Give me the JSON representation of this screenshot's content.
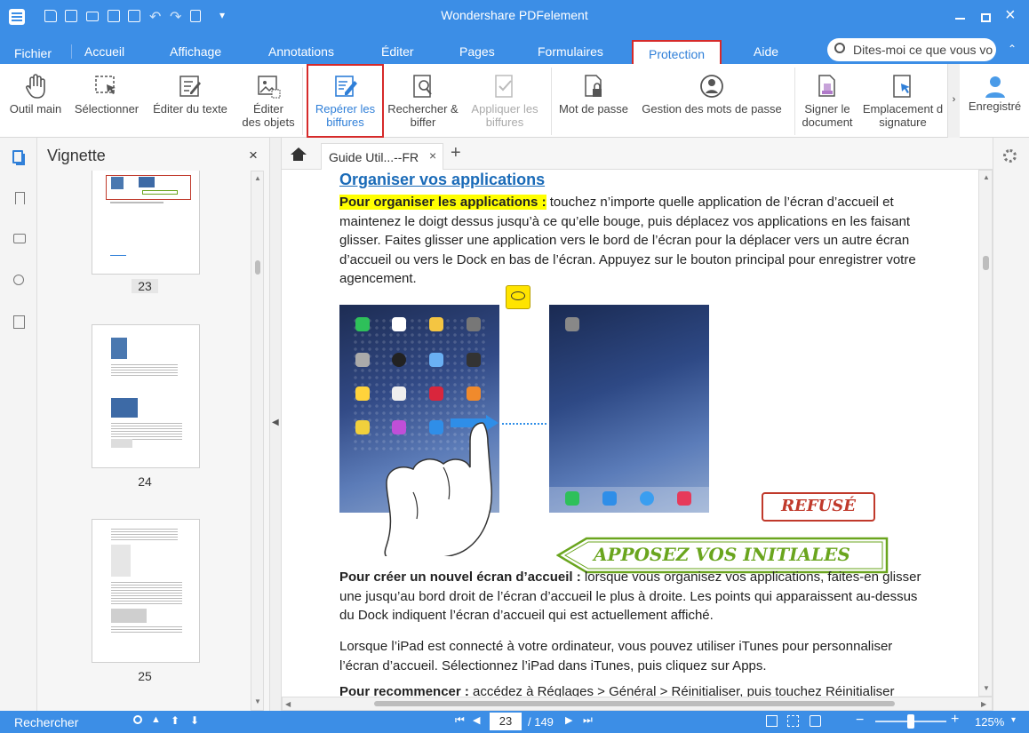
{
  "app": {
    "title": "Wondershare PDFelement"
  },
  "tabs": [
    {
      "label": "Fichier"
    },
    {
      "label": "Accueil"
    },
    {
      "label": "Affichage"
    },
    {
      "label": "Annotations"
    },
    {
      "label": "Éditer"
    },
    {
      "label": "Pages"
    },
    {
      "label": "Formulaires"
    },
    {
      "label": "Protection"
    },
    {
      "label": "Aide"
    }
  ],
  "search": {
    "placeholder": "Dites-moi ce que vous vo"
  },
  "ribbon": {
    "outil_main": {
      "l1": "Outil main",
      "l2": ""
    },
    "selectionner": {
      "l1": "Sélectionner",
      "l2": ""
    },
    "editer_texte": {
      "l1": "Éditer du texte",
      "l2": ""
    },
    "editer_objets": {
      "l1": "Éditer",
      "l2": "des objets"
    },
    "reperer": {
      "l1": "Repérer les",
      "l2": "biffures"
    },
    "rechercher": {
      "l1": "Rechercher &",
      "l2": "biffer"
    },
    "appliquer": {
      "l1": "Appliquer les",
      "l2": "biffures"
    },
    "mot_passe": {
      "l1": "Mot de passe",
      "l2": ""
    },
    "gestion": {
      "l1": "Gestion des mots de passe",
      "l2": ""
    },
    "signer": {
      "l1": "Signer le",
      "l2": "document"
    },
    "emplacement": {
      "l1": "Emplacement d",
      "l2": "signature"
    },
    "enregistre": {
      "l1": "Enregistré",
      "l2": ""
    }
  },
  "thumbs": {
    "title": "Vignette",
    "pages": [
      "23",
      "24",
      "25"
    ]
  },
  "doc": {
    "tab_label": "Guide Util...--FR",
    "heading": "Organiser vos applications",
    "p1_bold": "Pour organiser les applications :",
    "p1_text": " touchez n’importe quelle application de l’écran d’accueil et maintenez le doigt dessus jusqu’à ce qu’elle bouge, puis déplacez vos applications en les faisant glisser. Faites glisser une application vers le bord de l’écran pour la déplacer vers un autre écran d’accueil ou vers le Dock en bas de l’écran. Appuyez sur le bouton principal pour enregistrer votre agencement.",
    "stamp_refuse": "REFUSÉ",
    "stamp_initiales": "APPOSEZ VOS INITIALES",
    "p2_bold": "Pour créer un nouvel écran d’accueil :",
    "p2_text": " lorsque vous organisez vos applications, faites-en glisser une jusqu’au bord droit de l’écran d’accueil le plus à droite. Les points qui apparaissent au-dessus du Dock indiquent l’écran d’accueil qui est actuellement affiché.",
    "p3_text": "Lorsque l’iPad est connecté à votre ordinateur, vous pouvez utiliser iTunes pour personnaliser l’écran d’accueil. Sélectionnez l’iPad dans iTunes, puis cliquez sur Apps.",
    "p4_bold": "Pour recommencer :",
    "p4_text": " accédez à Réglages > Général > Réinitialiser, puis touchez Réinitialiser"
  },
  "status": {
    "search_label": "Rechercher",
    "page_current": "23",
    "page_total": "/ 149",
    "zoom": "125%"
  },
  "colors": {
    "accent": "#3c8ee6",
    "highlight": "#ffff00",
    "refuse": "#c0392b",
    "initiales": "#6aa51e",
    "heading": "#1a6bb8"
  }
}
